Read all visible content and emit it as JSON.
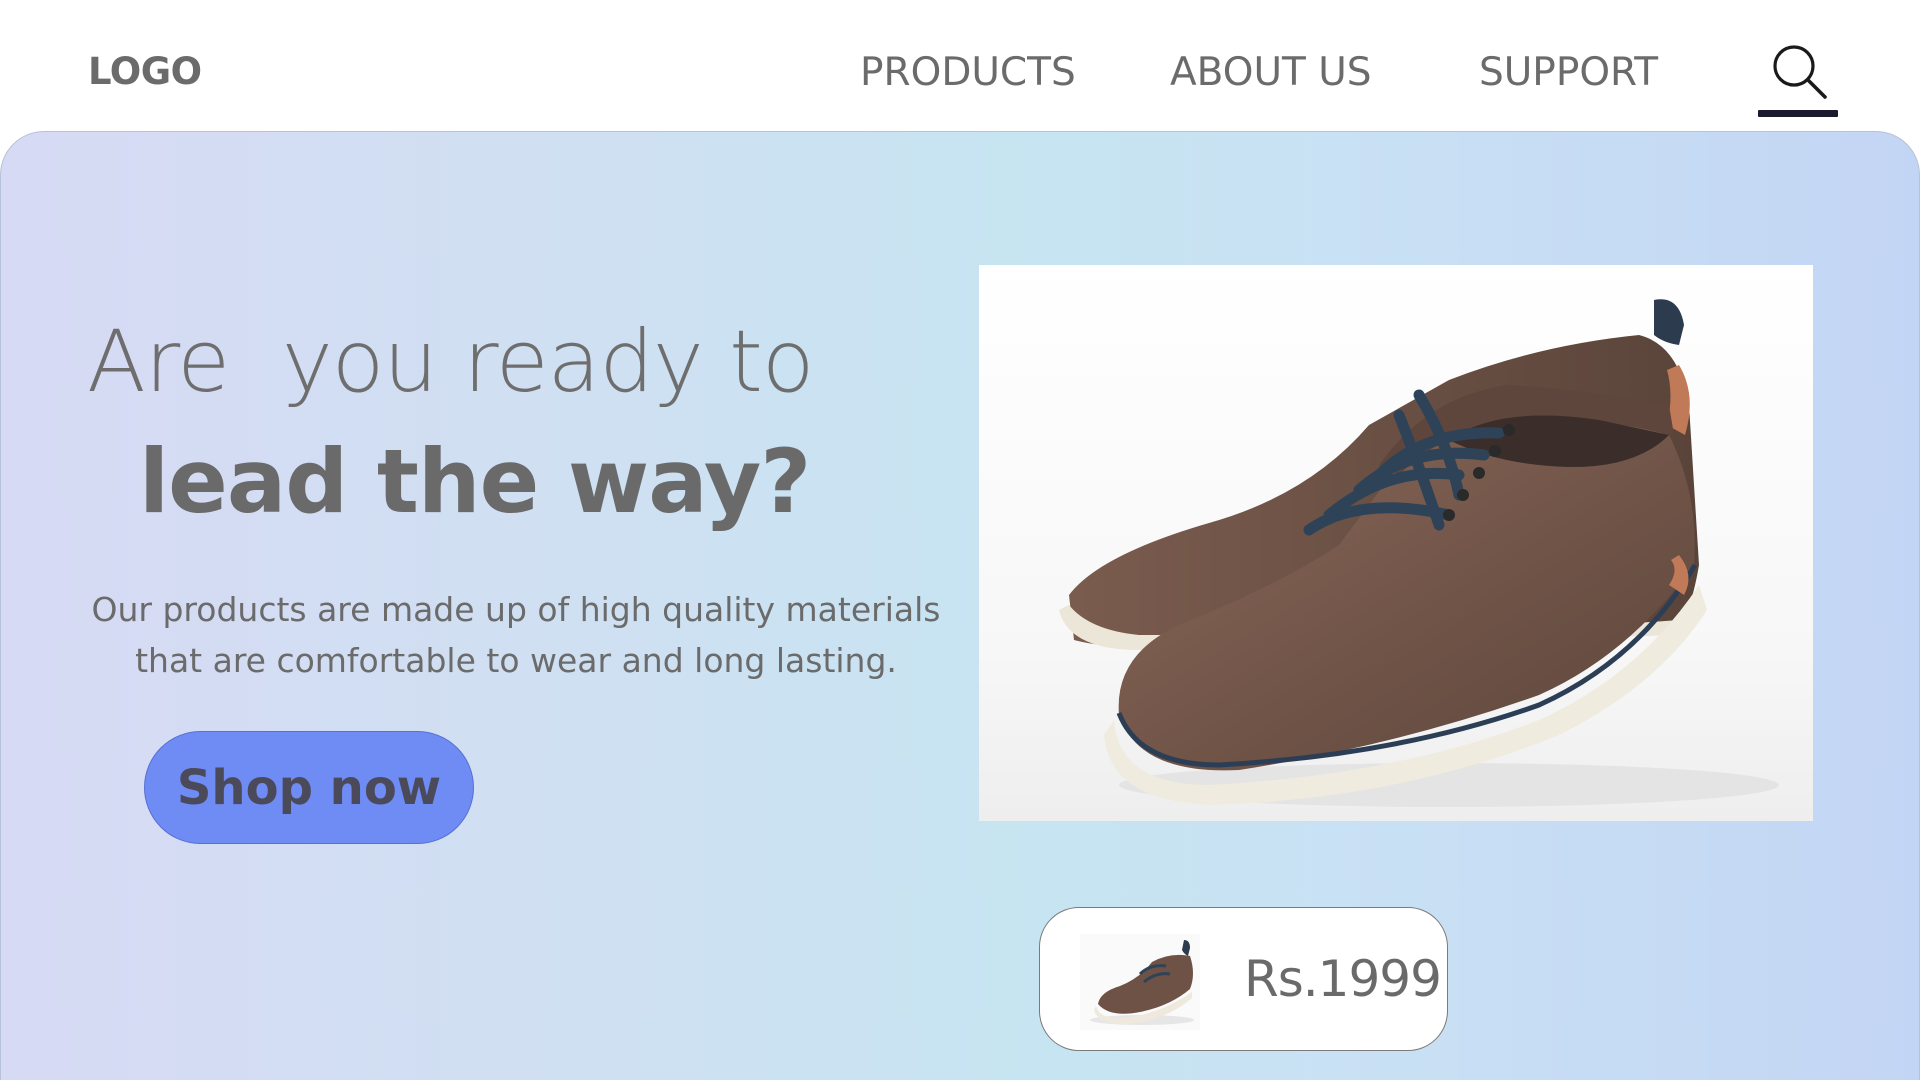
{
  "header": {
    "logo": "LOGO",
    "nav": [
      {
        "label": "PRODUCTS"
      },
      {
        "label": "ABOUT US"
      },
      {
        "label": "SUPPORT"
      }
    ],
    "search_icon": "search-icon"
  },
  "hero": {
    "headline_line1": "Are  you ready to",
    "headline_line2": "lead the way?",
    "description_line1": "Our products are made up of high quality materials",
    "description_line2": "that are comfortable to wear and long lasting.",
    "cta_label": "Shop now",
    "product_image": "brown-leather-sneaker",
    "price": "Rs.1999"
  },
  "colors": {
    "accent_button": "#6f8bf4",
    "text_gray": "#6b6b6b",
    "gradient_start": "#d7daf4",
    "gradient_mid": "#c6e4f1",
    "gradient_end": "#c3d5f4"
  }
}
